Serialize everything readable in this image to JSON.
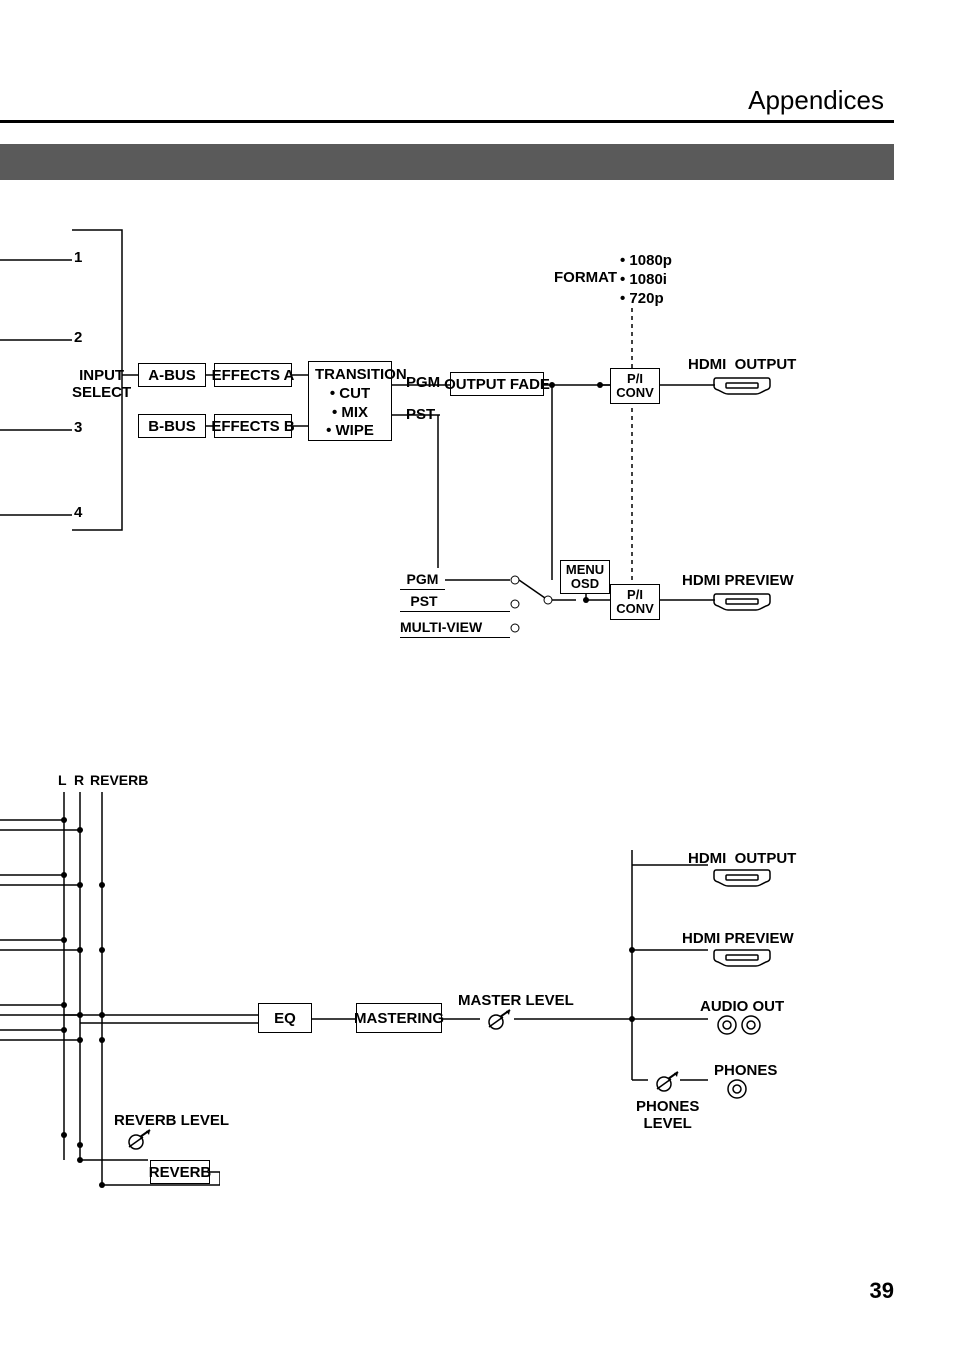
{
  "page": {
    "title": "Appendices",
    "number": "39"
  },
  "video": {
    "inputs": {
      "1": "1",
      "2": "2",
      "3": "3",
      "4": "4"
    },
    "input_select": "INPUT\nSELECT",
    "a_bus": "A-BUS",
    "b_bus": "B-BUS",
    "effects_a": "EFFECTS A",
    "effects_b": "EFFECTS B",
    "transition": "TRANSITION\n• CUT\n• MIX\n• WIPE",
    "pgm": "PGM",
    "pst": "PST",
    "output_fade": "OUTPUT FADE",
    "format_label": "FORMAT",
    "format_opts": "• 1080p\n• 1080i\n• 720p",
    "pi_conv": "P/I\nCONV",
    "hdmi_output": "HDMI  OUTPUT",
    "preview_pgm": "PGM",
    "preview_pst": "PST",
    "multi_view": "MULTI-VIEW",
    "menu_osd": "MENU\nOSD",
    "pi_conv2": "P/I\nCONV",
    "hdmi_preview": "HDMI PREVIEW"
  },
  "audio": {
    "header_l": "L",
    "header_r": "R",
    "header_reverb": "REVERB",
    "reverb_level": "REVERB LEVEL",
    "reverb": "REVERB",
    "eq": "EQ",
    "mastering": "MASTERING",
    "master_level": "MASTER LEVEL",
    "hdmi_output": "HDMI  OUTPUT",
    "hdmi_preview": "HDMI PREVIEW",
    "audio_out": "AUDIO OUT",
    "phones": "PHONES",
    "phones_level": "PHONES\nLEVEL"
  }
}
